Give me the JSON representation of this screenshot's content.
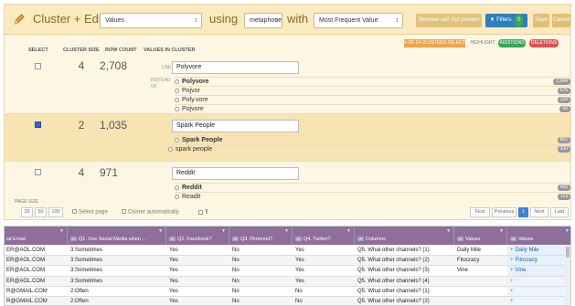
{
  "toolbar": {
    "title": "Cluster + Edit",
    "column_select": "Values",
    "using_label": "using",
    "function_select": "metaphone",
    "with_label": "with",
    "method_select": "Most Frequent Value",
    "remove_btn": "Remove cell: not present",
    "filters_btn": "Filters",
    "filters_count": "0",
    "save_btn": "Save",
    "cancel_btn": "Cancel"
  },
  "legend": {
    "selected": "4 OF 14 CLUSTERS SELECTED",
    "highlight": "HIGHLIGHT",
    "additions": "ADDITIONS",
    "deletions": "DELETIONS"
  },
  "columns": {
    "select": "SELECT",
    "size": "CLUSTER SIZE",
    "rows": "ROW COUNT",
    "values": "VALUES IN CLUSTER"
  },
  "labels": {
    "use": "USE",
    "instead_of": "INSTEAD OF"
  },
  "clusters": [
    {
      "checked": false,
      "size": "4",
      "count": "2,708",
      "use": "Polyvore",
      "values": [
        {
          "text": "Polyvore",
          "n": "2,044"
        },
        {
          "text": "Pojvor",
          "n": "675"
        },
        {
          "text": "Poly.vore",
          "n": "120"
        },
        {
          "text": "Pojvore",
          "n": "69"
        }
      ]
    },
    {
      "checked": true,
      "size": "2",
      "count": "1,035",
      "use": "Spark People",
      "values": [
        {
          "text": "Spark People",
          "n": "805"
        },
        {
          "text": "spark people",
          "n": "230"
        }
      ]
    },
    {
      "checked": false,
      "size": "4",
      "count": "971",
      "use": "Reddit",
      "values": [
        {
          "text": "Reddit",
          "n": "460"
        },
        {
          "text": "Readit",
          "n": "113"
        }
      ]
    }
  ],
  "pager": {
    "label": "PAGE SIZE",
    "sizes": [
      "25",
      "50",
      "100"
    ],
    "select_page": "Select page",
    "cluster_auto": "Cluster automatically",
    "first": "First",
    "previous": "Previous",
    "page": "1",
    "next": "Next",
    "last": "Last"
  },
  "grid": {
    "headers": [
      {
        "tag": "",
        "label": "ial Email"
      },
      {
        "tag": "A",
        "label": "Q1. Use Social Media when ..."
      },
      {
        "tag": "A",
        "label": "Q2. Facebook?"
      },
      {
        "tag": "A",
        "label": "Q3. Pinterest?"
      },
      {
        "tag": "A",
        "label": "Q4. Twitter?"
      },
      {
        "tag": "A",
        "label": "Columns"
      },
      {
        "tag": "A",
        "label": "Values"
      },
      {
        "tag": "A",
        "label": "Values"
      }
    ],
    "rows": [
      [
        "ER@AOL.COM",
        "3:Sometimes",
        "Yes",
        "No",
        "Yes",
        "Q5. What other channels? (1)",
        "Daily Mile",
        "Daily Mile"
      ],
      [
        "ER@AOL.COM",
        "3:Sometimes",
        "Yes",
        "No",
        "Yes",
        "Q5. What other channels? (2)",
        "Fitocracy",
        "Fitocracy"
      ],
      [
        "ER@AOL.COM",
        "3:Sometimes",
        "Yes",
        "No",
        "Yes",
        "Q5. What other channels? (3)",
        "Vine",
        "Vine"
      ],
      [
        "ER@AOL.COM",
        "3:Sometimes",
        "Yes",
        "No",
        "Yes",
        "Q5. What other channels? (4)",
        "",
        ""
      ],
      [
        "R@GMAIL.COM",
        "2:Often",
        "Yes",
        "No",
        "No",
        "Q5. What other channels? (1)",
        "",
        ""
      ],
      [
        "R@GMAIL.COM",
        "2:Often",
        "Yes",
        "No",
        "No",
        "Q5. What other channels? (2)",
        "",
        ""
      ]
    ]
  },
  "colors": {
    "accent": "#8e6f9c",
    "panel": "#fdf6e3",
    "toolbar": "#fbeac0",
    "additions": "#3aa655",
    "deletions": "#d9534f",
    "selected": "#f0a64b",
    "link": "#1a5fb4"
  }
}
